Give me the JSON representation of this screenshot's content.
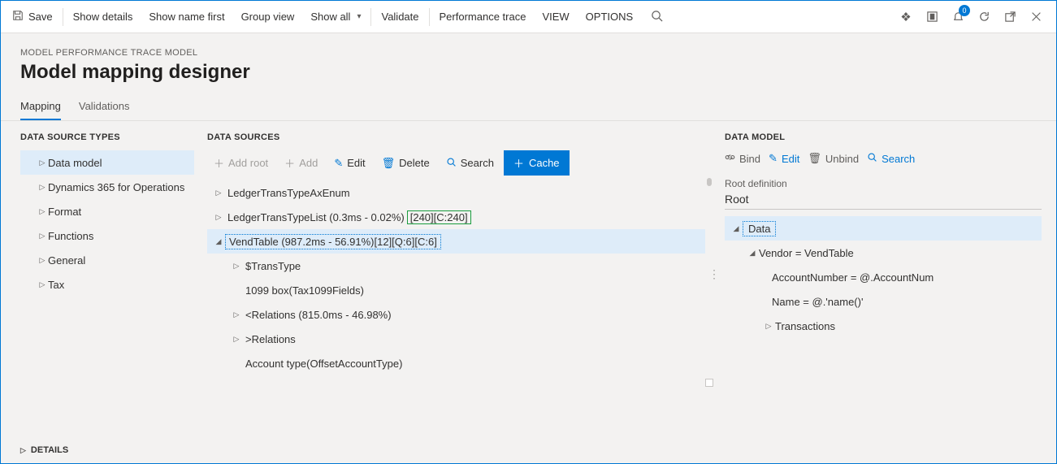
{
  "cmdbar": {
    "save": "Save",
    "show_details": "Show details",
    "show_name_first": "Show name first",
    "group_view": "Group view",
    "show_all": "Show all",
    "validate": "Validate",
    "perf_trace": "Performance trace",
    "view": "VIEW",
    "options": "OPTIONS",
    "bell_count": "0"
  },
  "header": {
    "crumb": "MODEL PERFORMANCE TRACE MODEL",
    "title": "Model mapping designer"
  },
  "tabs": {
    "mapping": "Mapping",
    "validations": "Validations"
  },
  "types": {
    "head": "DATA SOURCE TYPES",
    "items": [
      "Data model",
      "Dynamics 365 for Operations",
      "Format",
      "Functions",
      "General",
      "Tax"
    ]
  },
  "sources": {
    "head": "DATA SOURCES",
    "toolbar": {
      "add_root": "Add root",
      "add": "Add",
      "edit": "Edit",
      "delete": "Delete",
      "search": "Search",
      "cache": "Cache"
    },
    "rows": {
      "r0": "LedgerTransTypeAxEnum",
      "r1_a": "LedgerTransTypeList (0.3ms - 0.02%)",
      "r1_b": "[240][C:240]",
      "r2": "VendTable (987.2ms - 56.91%)[12][Q:6][C:6]",
      "r3": "$TransType",
      "r4": "1099 box(Tax1099Fields)",
      "r5": "<Relations (815.0ms - 46.98%)",
      "r6": ">Relations",
      "r7": "Account type(OffsetAccountType)"
    }
  },
  "details": "DETAILS",
  "model": {
    "head": "DATA MODEL",
    "toolbar": {
      "bind": "Bind",
      "edit": "Edit",
      "unbind": "Unbind",
      "search": "Search"
    },
    "root_label": "Root definition",
    "root_value": "Root",
    "rows": {
      "data": "Data",
      "vendor": "Vendor = VendTable",
      "acct": "AccountNumber = @.AccountNum",
      "name": "Name = @.'name()'",
      "trans": "Transactions"
    }
  }
}
